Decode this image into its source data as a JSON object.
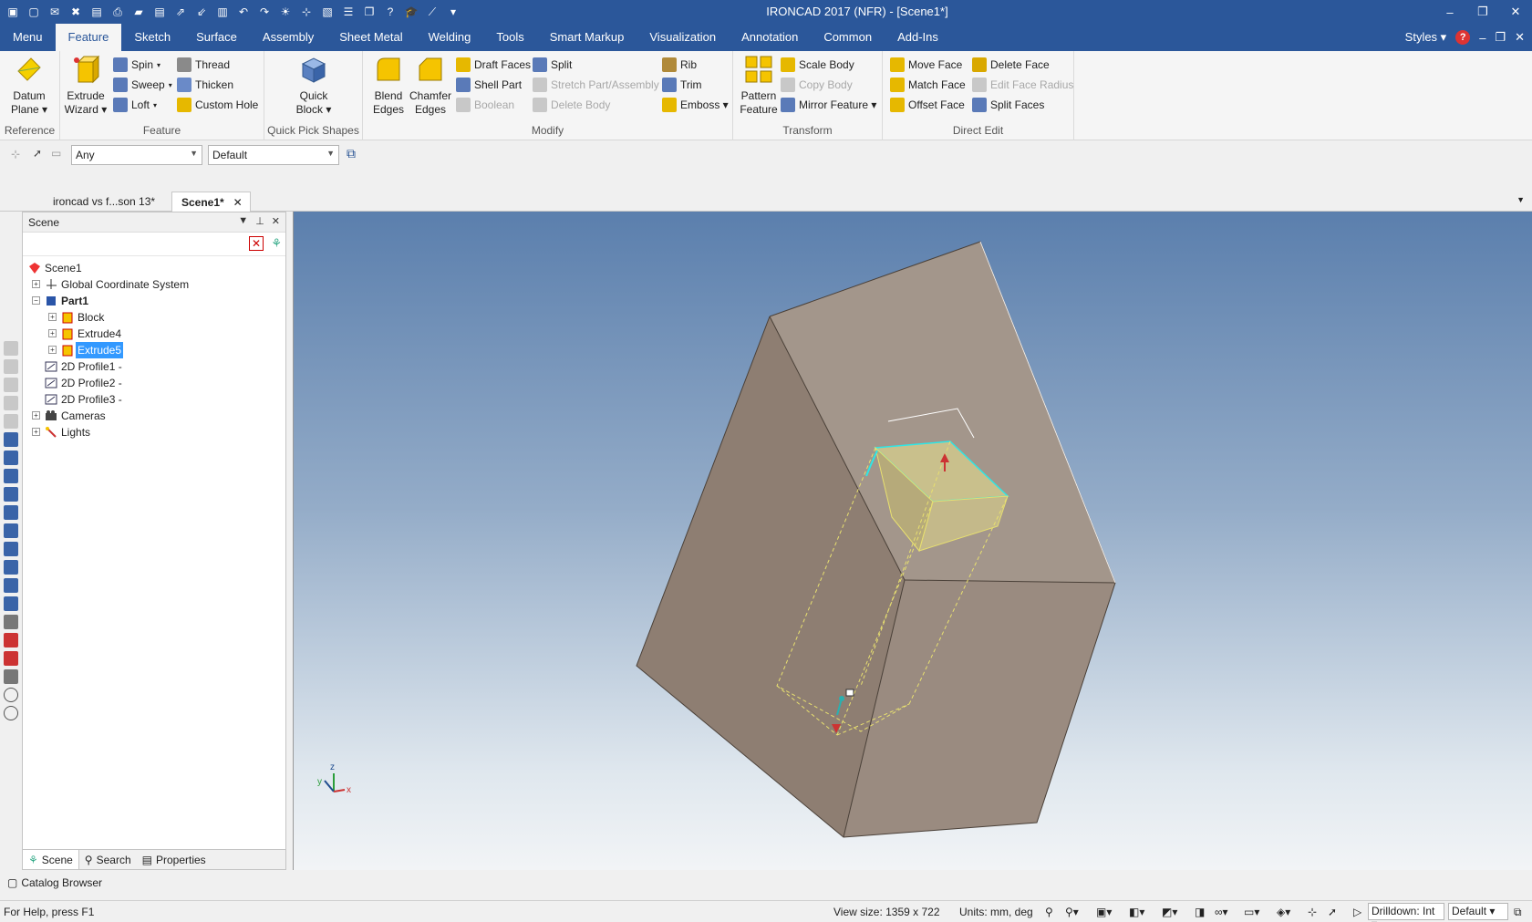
{
  "window": {
    "title": "IRONCAD 2017 (NFR) - [Scene1*]",
    "controls": [
      "–",
      "❐",
      "✕"
    ]
  },
  "quick_access_icons": [
    "app-icon",
    "new-icon",
    "open-icon",
    "close-icon",
    "save-icon",
    "print-icon",
    "folder-icon",
    "save-icon",
    "export-icon",
    "import-icon",
    "catalog-icon",
    "undo-icon",
    "redo-icon",
    "light-icon",
    "tri-icon",
    "box-icon",
    "list-icon",
    "window-icon",
    "help-icon",
    "graduation-icon",
    "line-icon",
    "more-icon"
  ],
  "ribbon": {
    "tabs": [
      "Menu",
      "Feature",
      "Sketch",
      "Surface",
      "Assembly",
      "Sheet Metal",
      "Welding",
      "Tools",
      "Smart Markup",
      "Visualization",
      "Annotation",
      "Common",
      "Add-Ins"
    ],
    "active_tab": "Feature",
    "styles_label": "Styles",
    "inner_controls": [
      "?",
      "–",
      "❐",
      "✕"
    ],
    "groups": {
      "reference": {
        "label": "Reference",
        "datum_plane": [
          "Datum",
          "Plane ▾"
        ]
      },
      "feature": {
        "label": "Feature",
        "extrude_wizard": [
          "Extrude",
          "Wizard ▾"
        ],
        "spin": "Spin",
        "sweep": "Sweep",
        "loft": "Loft",
        "thread": "Thread",
        "thicken": "Thicken",
        "custom_hole": "Custom Hole"
      },
      "quick_pick": {
        "label": "Quick Pick Shapes",
        "quick_block": [
          "Quick",
          "Block ▾"
        ]
      },
      "modify": {
        "label": "Modify",
        "blend_edges": [
          "Blend",
          "Edges"
        ],
        "chamfer_edges": [
          "Chamfer",
          "Edges"
        ],
        "draft_faces": "Draft Faces",
        "shell_part": "Shell Part",
        "boolean": "Boolean",
        "split": "Split",
        "stretch": "Stretch Part/Assembly",
        "delete_body": "Delete Body",
        "rib": "Rib",
        "trim": "Trim",
        "emboss": "Emboss ▾"
      },
      "transform": {
        "label": "Transform",
        "pattern_feature": [
          "Pattern",
          "Feature"
        ],
        "scale_body": "Scale Body",
        "copy_body": "Copy Body",
        "mirror_feature": "Mirror Feature ▾"
      },
      "direct_edit": {
        "label": "Direct Edit",
        "move_face": "Move Face",
        "match_face": "Match Face",
        "offset_face": "Offset Face",
        "delete_face": "Delete Face",
        "edit_face_radius": "Edit Face Radius",
        "split_faces": "Split Faces"
      }
    }
  },
  "selection_bar": {
    "filter_value": "Any",
    "style_value": "Default"
  },
  "doc_tabs": [
    {
      "label": "ironcad vs f...son 13*",
      "active": false
    },
    {
      "label": "Scene1*",
      "active": true
    }
  ],
  "scene_panel": {
    "title": "Scene",
    "tree": [
      {
        "label": "Scene1",
        "icon": "scene-icon",
        "expander": ""
      },
      {
        "label": "Global Coordinate System",
        "icon": "axes-icon",
        "expander": "+"
      },
      {
        "label": "Part1",
        "icon": "part-icon",
        "expander": "−",
        "bold": true
      },
      {
        "label": "Block",
        "icon": "feature-icon",
        "expander": "+"
      },
      {
        "label": "Extrude4",
        "icon": "feature-icon",
        "expander": "+"
      },
      {
        "label": "Extrude5",
        "icon": "feature-icon",
        "expander": "+",
        "selected": true
      },
      {
        "label": "2D Profile1 -",
        "icon": "profile-icon",
        "expander": ""
      },
      {
        "label": "2D Profile2 -",
        "icon": "profile-icon",
        "expander": ""
      },
      {
        "label": "2D Profile3 -",
        "icon": "profile-icon",
        "expander": ""
      },
      {
        "label": "Cameras",
        "icon": "camera-icon",
        "expander": "+"
      },
      {
        "label": "Lights",
        "icon": "light-icon",
        "expander": "+"
      }
    ],
    "bottom_tabs": [
      "Scene",
      "Search",
      "Properties"
    ]
  },
  "viewport": {
    "triad": {
      "x": "x",
      "y": "y",
      "z": "z"
    }
  },
  "catalog_browser": "Catalog Browser",
  "status": {
    "help": "For Help, press F1",
    "view_size": "View size: 1359 x  722",
    "units": "Units: mm, deg",
    "drilldown": "Drilldown: Int",
    "default": "Default"
  },
  "colors": {
    "title_blue": "#2b579a",
    "selection_blue": "#3399ff",
    "part_face": "#9c8b7f",
    "highlight_cyan": "#2ee6e6",
    "highlight_yellow": "#e8e070"
  }
}
